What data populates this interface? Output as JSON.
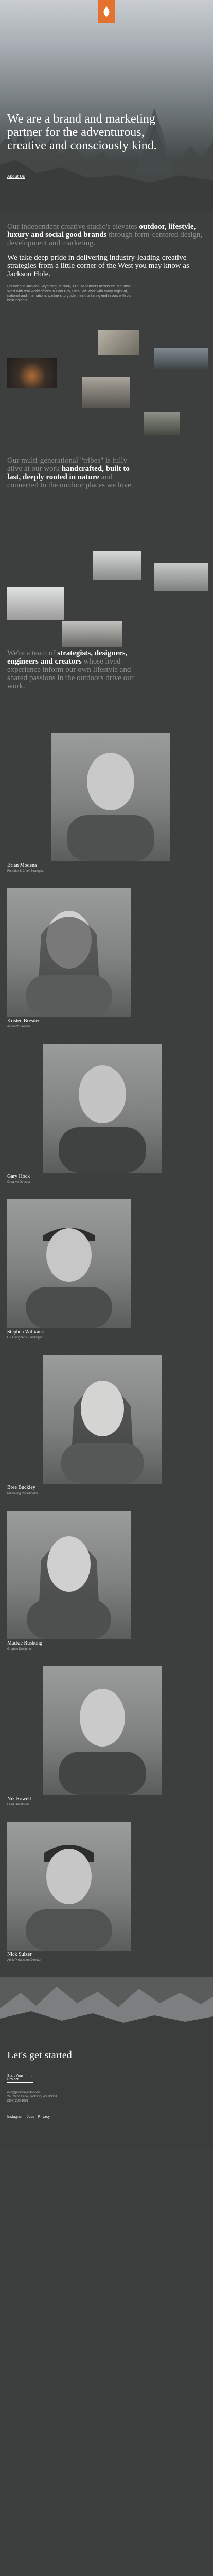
{
  "hero": {
    "logo_icon": "brand-mark-icon",
    "headline": "We are a brand and marketing partner for the adventurous, creative and consciously kind.",
    "about_link": "About Us"
  },
  "intro": {
    "p1_a": "Our independent creative studio's elevates ",
    "p1_b": "outdoor, lifestyle, luxury and social good brands",
    "p1_c": " through form-centered design, development and marketing.",
    "p2": "We take deep pride in delivering industry-leading creative strategies from a little corner of the West you may know as Jackson Hole.",
    "small": "Founded in Jackson, Wyoming, in 2006, 1ThEM partners across the Mountain West with real-world offices in Park City, Utah. We work with today regional, national and international partners to guide their marketing endeavors with our best insights."
  },
  "handcrafted": {
    "a": "Our multi-generational \"tribes\" is fully alive at our work ",
    "b": "handcrafted, built to last, deeply rooted in nature",
    "c": " and connected to the outdoor places we love."
  },
  "strategists": {
    "a": "We're a team of ",
    "b": "strategists, designers, engineers and creators",
    "c": " whose lived experience inform our own lifestyle and shared passions in the outdoors drive our work."
  },
  "team": [
    {
      "name": "Brian Modena",
      "title": "Founder & Chief Strategist"
    },
    {
      "name": "Kristen Bresder",
      "title": "Account Director"
    },
    {
      "name": "Gary Hock",
      "title": "Creative Director"
    },
    {
      "name": "Stephen Williams",
      "title": "UX Designer & Developer"
    },
    {
      "name": "Bree Buckley",
      "title": "Marketing Coordinator"
    },
    {
      "name": "Mackie Rushong",
      "title": "Graphic Designer"
    },
    {
      "name": "Nik Rowell",
      "title": "Lead Developer"
    },
    {
      "name": "Nick Sulzer",
      "title": "Art & Production Director"
    }
  ],
  "footer": {
    "heading": "Let's get started",
    "start_label": "Start Your Project",
    "start_arrow": "→",
    "email": "info@jacksonvisitor.com",
    "address": "245 Scott Lane, Jackson, WY 83001",
    "phone": "(307) 200-1081",
    "links": [
      "Instagram",
      "Jobs",
      "Privacy"
    ]
  },
  "colors": {
    "accent": "#e5712f",
    "background": "#3d3f3f",
    "muted_text": "#8c8f8f"
  }
}
